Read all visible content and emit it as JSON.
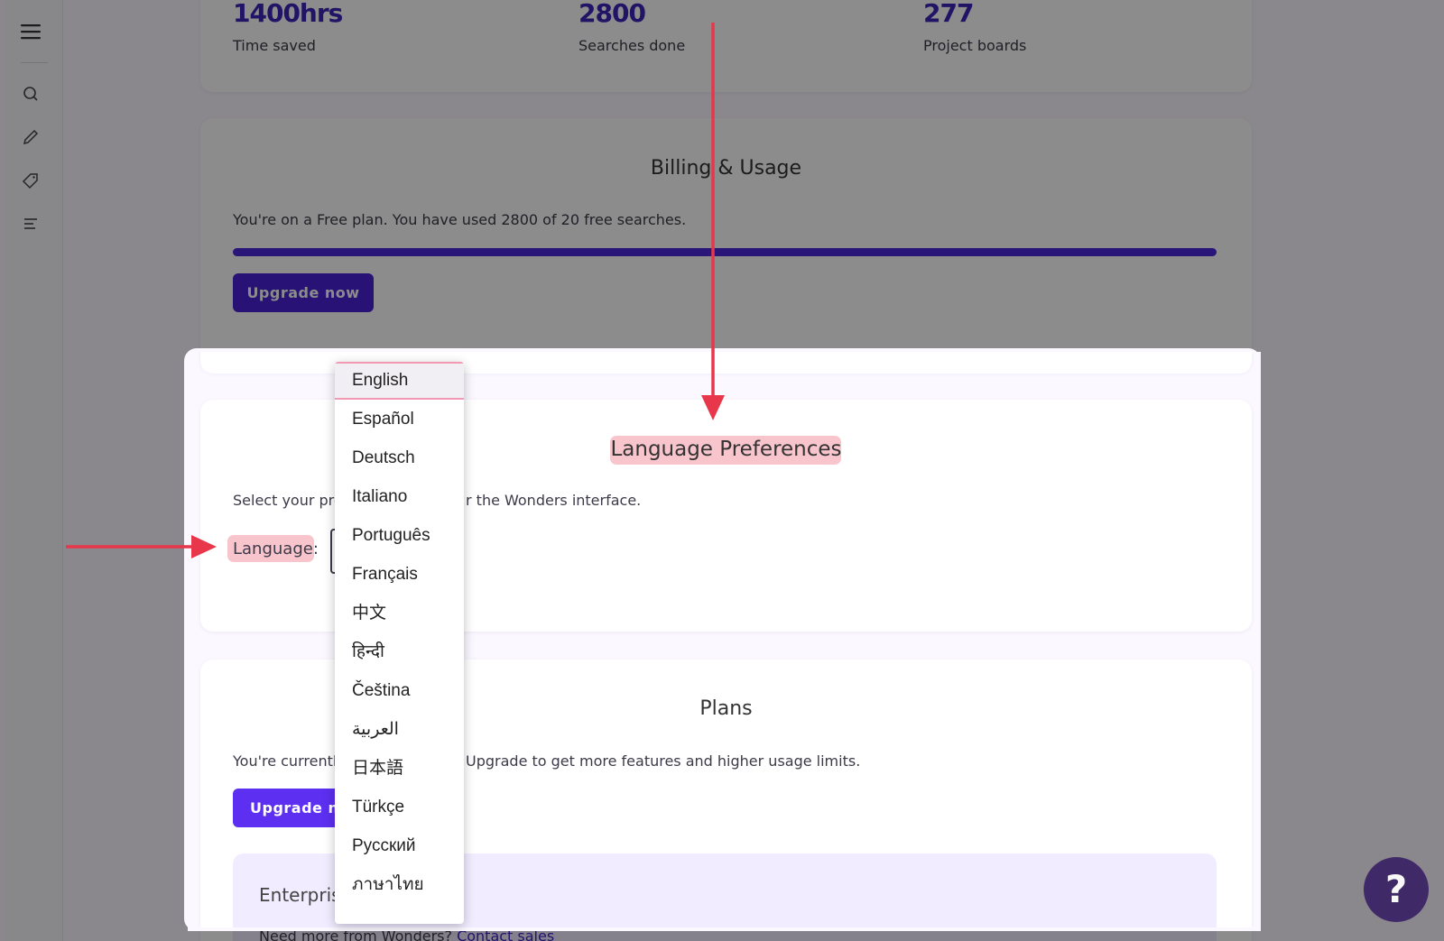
{
  "sidebar": {
    "icons": [
      "menu-icon",
      "search-icon",
      "pencil-icon",
      "tag-icon",
      "list-icon"
    ]
  },
  "stats": [
    {
      "value": "1400hrs",
      "label": "Time saved"
    },
    {
      "value": "2800",
      "label": "Searches done"
    },
    {
      "value": "277",
      "label": "Project boards"
    }
  ],
  "billing": {
    "title": "Billing & Usage",
    "text": "You're on a Free plan. You have used 2800 of 20 free searches.",
    "usage_fraction": 1.0,
    "upgrade_label": "Upgrade now"
  },
  "language": {
    "title": "Language Preferences",
    "text_left": "Select your pre",
    "text_right": "r the Wonders interface.",
    "label": "Language:",
    "options": [
      "English",
      "Español",
      "Deutsch",
      "Italiano",
      "Português",
      "Français",
      "中文",
      "हिन्दी",
      "Čeština",
      "العربية",
      "日本語",
      "Türkçe",
      "Русский",
      "ภาษาไทย"
    ],
    "selected": "English"
  },
  "plans": {
    "title": "Plans",
    "text_left": "You're currentl",
    "text_right": "Upgrade to get more features and higher usage limits.",
    "upgrade_label": "Upgrade n",
    "enterprise_title": "Enterpris",
    "enterprise_text": "Need more from Wonders?",
    "contact_label": "Contact sales"
  },
  "help": {
    "label": "?"
  },
  "colors": {
    "accent": "#4a22d6",
    "annotation_red": "#e8364a",
    "highlight_pink": "#f8c5cd"
  }
}
